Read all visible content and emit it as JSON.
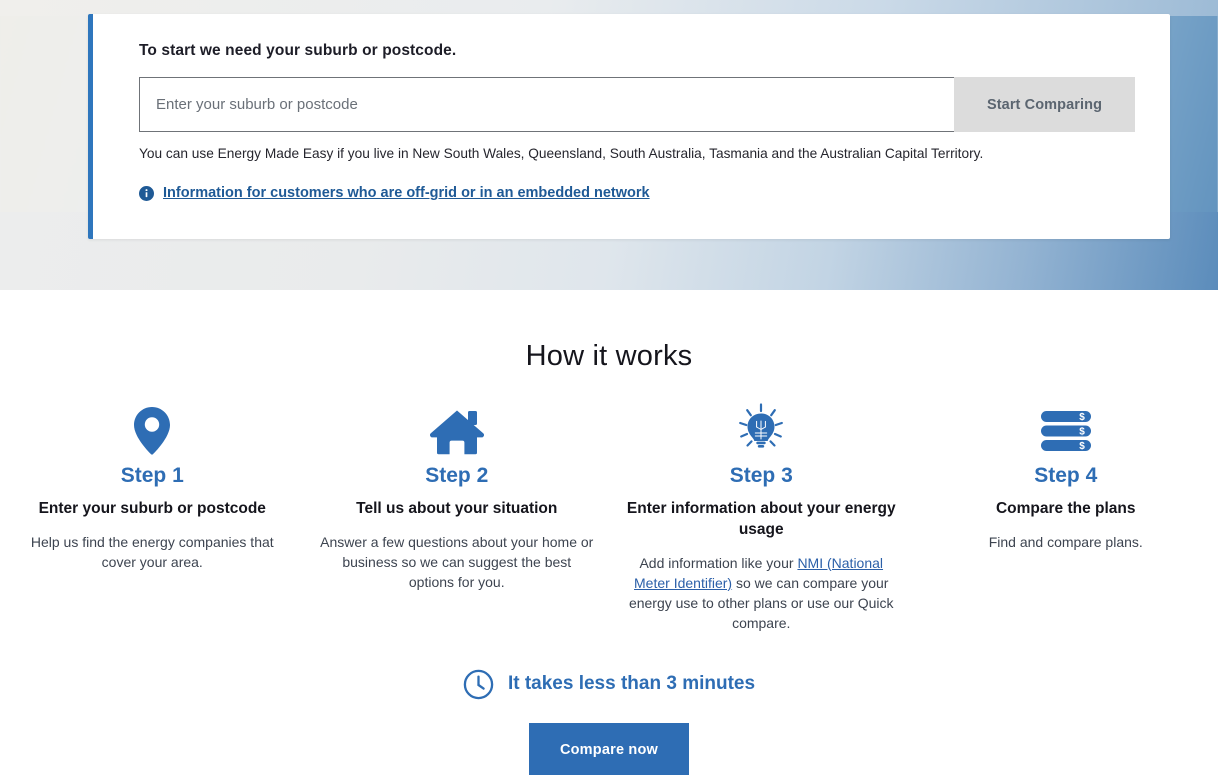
{
  "hero": {
    "card": {
      "heading": "To start we need your suburb or postcode.",
      "input_placeholder": "Enter your suburb or postcode",
      "input_value": "",
      "start_button_label": "Start Comparing",
      "coverage_note": "You can use Energy Made Easy if you live in New South Wales, Queensland, South Australia, Tasmania and the Australian Capital Territory.",
      "offgrid_link_label": "Information for customers who are off-grid or in an embedded network",
      "info_icon": "info-circle-icon"
    },
    "accent_color": "#2e76bd",
    "disabled_button_color": "#dcdcdc"
  },
  "how_it_works": {
    "title": "How it works",
    "steps": [
      {
        "icon": "map-pin-icon",
        "label": "Step 1",
        "heading": "Enter your suburb or postcode",
        "body": "Help us find the energy companies that cover your area."
      },
      {
        "icon": "house-icon",
        "label": "Step 2",
        "heading": "Tell us about your situation",
        "body": "Answer a few questions about your home or business so we can suggest the best options for you."
      },
      {
        "icon": "lightbulb-icon",
        "label": "Step 3",
        "heading": "Enter information about your energy usage",
        "body_before_link": "Add information like your ",
        "body_link": "NMI (National Meter Identifier)",
        "body_after_link": " so we can compare your energy use to other plans or use our Quick compare."
      },
      {
        "icon": "plan-bars-dollar-icon",
        "label": "Step 4",
        "heading": "Compare the plans",
        "body": "Find and compare plans."
      }
    ]
  },
  "cta": {
    "clock_icon": "clock-icon",
    "time_text": "It takes less than 3 minutes",
    "compare_button_label": "Compare now",
    "primary_color": "#2e6db4"
  }
}
